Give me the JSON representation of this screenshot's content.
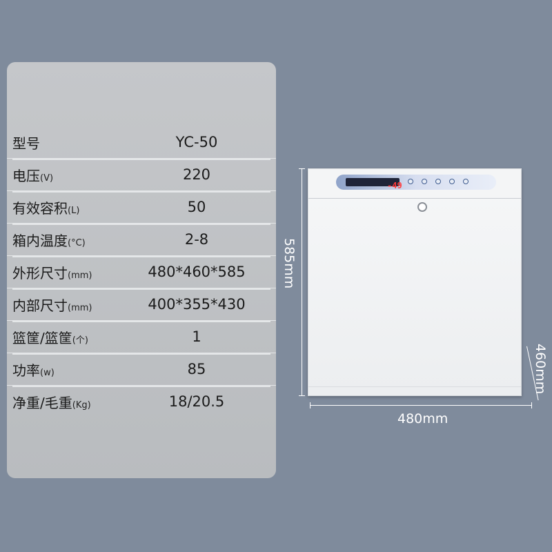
{
  "specs": [
    {
      "label": "型号",
      "unit": "",
      "value": "YC-50"
    },
    {
      "label": "电压",
      "unit": "(V)",
      "value": "220"
    },
    {
      "label": "有效容积",
      "unit": "(L)",
      "value": "50"
    },
    {
      "label": "箱内温度",
      "unit": "(°C)",
      "value": "2-8"
    },
    {
      "label": "外形尺寸",
      "unit": "(mm)",
      "value": "480*460*585"
    },
    {
      "label": "内部尺寸",
      "unit": "(mm)",
      "value": "400*355*430"
    },
    {
      "label": "篮筐/篮筐",
      "unit": "(个)",
      "value": "1"
    },
    {
      "label": "功率",
      "unit": "(w)",
      "value": "85"
    },
    {
      "label": "净重/毛重",
      "unit": "(Kg)",
      "value": "18/20.5"
    }
  ],
  "product": {
    "display_reading": "-49",
    "height_label": "585mm",
    "width_label": "480mm",
    "depth_label": "460mm"
  },
  "colors": {
    "background": "#7f8b9c",
    "panel": "#c1c3c6",
    "display_digits": "#ff3b3b"
  }
}
